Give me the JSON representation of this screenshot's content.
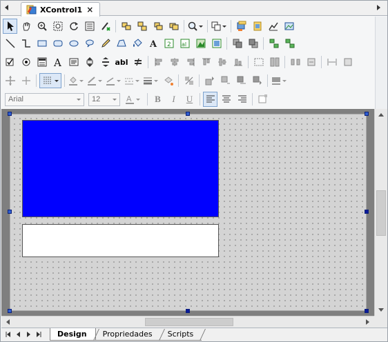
{
  "document_tab": {
    "title": "XControl1",
    "close_glyph": "×"
  },
  "toolbars": {
    "row1_icons": [
      "pointer-icon",
      "hand-icon",
      "zoom-icon",
      "zoom-fit-icon",
      "refresh-icon",
      "tab-order-icon",
      "edit-script-icon",
      "align-group-1-icon",
      "align-group-2-icon",
      "align-group-3-icon",
      "align-group-4-icon",
      "search-icon",
      "copy-format-icon",
      "properties-icon",
      "database-icon",
      "chart-icon",
      "image-edit-icon"
    ],
    "row2_icons": [
      "line-icon",
      "connector-icon",
      "rectangle-icon",
      "rounded-rect-icon",
      "ellipse-icon",
      "bubble-icon",
      "pencil-icon",
      "polygon-icon",
      "bucket-icon",
      "text-icon",
      "number-icon",
      "display-icon",
      "bitmap-icon",
      "picture-icon",
      "bring-front-icon",
      "send-back-icon",
      "group-icon",
      "ungroup-icon"
    ],
    "row3_icons": [
      "checkbox-icon",
      "radio-icon",
      "listbox-icon",
      "label-a-icon",
      "textbox-icon",
      "spinner-icon",
      "slider-icon",
      "abl-icon",
      "equal-icon",
      "align-left-icon",
      "align-center-icon",
      "align-right-icon",
      "align-top-icon",
      "align-middle-icon",
      "align-bottom-icon",
      "size-icon",
      "space-icon",
      "distribute-icon"
    ],
    "row3_text_button": "abl",
    "font_name": "Arial",
    "font_size": "12",
    "bold_label": "B",
    "italic_label": "I",
    "underline_label": "U"
  },
  "canvas": {
    "surface_color": "#d4d4d4",
    "blue_control_color": "#0000ff",
    "white_control_color": "#ffffff"
  },
  "bottom_tabs": {
    "tabs": [
      "Design",
      "Propriedades",
      "Scripts"
    ],
    "active": "Design"
  }
}
